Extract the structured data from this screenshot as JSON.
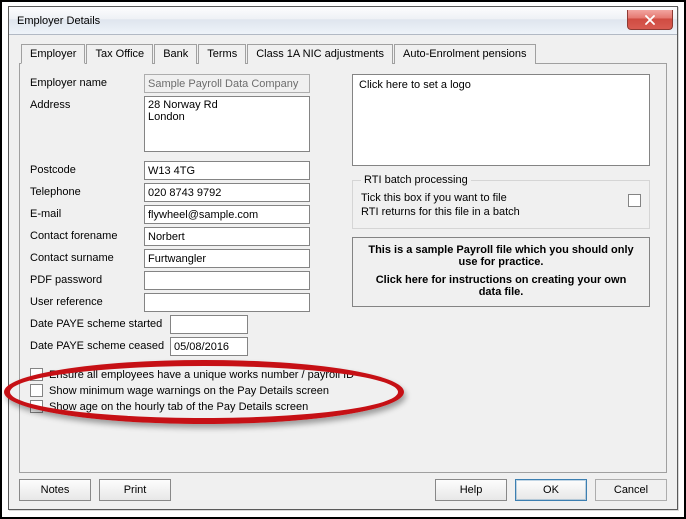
{
  "window": {
    "title": "Employer Details"
  },
  "tabs": [
    "Employer",
    "Tax Office",
    "Bank",
    "Terms",
    "Class 1A NIC adjustments",
    "Auto-Enrolment pensions"
  ],
  "form": {
    "labels": {
      "employer_name": "Employer name",
      "address": "Address",
      "postcode": "Postcode",
      "telephone": "Telephone",
      "email": "E-mail",
      "contact_forename": "Contact forename",
      "contact_surname": "Contact surname",
      "pdf_password": "PDF password",
      "user_reference": "User reference",
      "paye_started": "Date PAYE scheme started",
      "paye_ceased": "Date PAYE scheme ceased"
    },
    "values": {
      "employer_name": "Sample Payroll Data Company",
      "address": "28 Norway Rd\nLondon",
      "postcode": "W13 4TG",
      "telephone": "020 8743 9792",
      "email": "flywheel@sample.com",
      "contact_forename": "Norbert",
      "contact_surname": "Furtwangler",
      "pdf_password": "",
      "user_reference": "",
      "paye_started": "",
      "paye_ceased": "05/08/2016"
    }
  },
  "logo": {
    "placeholder": "Click here to set a logo"
  },
  "rti": {
    "legend": "RTI batch processing",
    "text_l1": "Tick this box if you want to file",
    "text_l2": "RTI returns for this file in a batch"
  },
  "info": {
    "line1": "This is a sample Payroll file which you should only use for practice.",
    "line2": "Click here for instructions on creating your own data file."
  },
  "checks": {
    "unique_works": "Ensure all employees have a unique works number / payroll ID",
    "min_wage": "Show minimum wage warnings on the Pay Details screen",
    "show_age": "Show age on the hourly tab of the Pay Details screen"
  },
  "buttons": {
    "notes": "Notes",
    "print": "Print",
    "help": "Help",
    "ok": "OK",
    "cancel": "Cancel"
  }
}
